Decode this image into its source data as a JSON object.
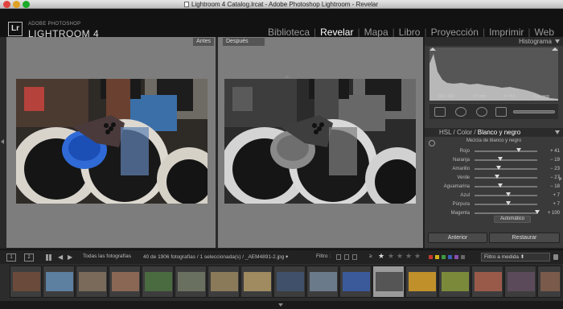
{
  "window": {
    "title": "Lightroom 4 Catalog.lrcat - Adobe Photoshop Lightroom - Revelar"
  },
  "brand": {
    "logo": "Lr",
    "small": "ADOBE PHOTOSHOP",
    "big": "LIGHTROOM 4"
  },
  "modules": [
    {
      "label": "Biblioteca"
    },
    {
      "label": "Revelar"
    },
    {
      "label": "Mapa"
    },
    {
      "label": "Libro"
    },
    {
      "label": "Proyección"
    },
    {
      "label": "Imprimir"
    },
    {
      "label": "Web"
    }
  ],
  "view": {
    "before_label": "Antes",
    "after_label": "Después"
  },
  "histogram": {
    "title": "Histograma",
    "iso": "ISO 100",
    "focal": "17 mm",
    "aperture": "f / 4,0",
    "shutter": "¹⁄₁₂₅ seg"
  },
  "hsl": {
    "tab_hsl": "HSL",
    "tab_sep1": "/",
    "tab_color": "Color",
    "tab_sep2": "/",
    "tab_bw": "Blanco y negro",
    "mix_title": "Mezcla de blanco y negro",
    "sliders": [
      {
        "label": "Rojo",
        "value": "+ 41",
        "level": 41
      },
      {
        "label": "Naranja",
        "value": "− 19",
        "level": -19
      },
      {
        "label": "Amarillo",
        "value": "− 23",
        "level": -23
      },
      {
        "label": "Verde",
        "value": "− 27",
        "level": -27
      },
      {
        "label": "Aguamarina",
        "value": "− 18",
        "level": -18
      },
      {
        "label": "Azul",
        "value": "+ 7",
        "level": 7
      },
      {
        "label": "Púrpura",
        "value": "+ 7",
        "level": 7
      },
      {
        "label": "Magenta",
        "value": "+ 100",
        "level": 100
      }
    ],
    "auto_label": "Automático"
  },
  "buttons": {
    "previous": "Anterior",
    "reset": "Restaurar"
  },
  "filmbar": {
    "view1": "1",
    "view2": "2",
    "source": "Todas las fotografías",
    "count": "40 de 1906 fotografías / 1 seleccionada(s) / _AEM4891-2.jpg ▾",
    "filter_label": "Filtro :",
    "rating_op": "≥",
    "filter_value": "Filtro a medida ⬍"
  },
  "colors": {
    "label_red": "#c0392b",
    "label_yellow": "#d4b21a",
    "label_green": "#3f9a3f",
    "label_blue": "#3b5fb3",
    "label_purple": "#8a4fb0",
    "label_gray": "#666666"
  }
}
